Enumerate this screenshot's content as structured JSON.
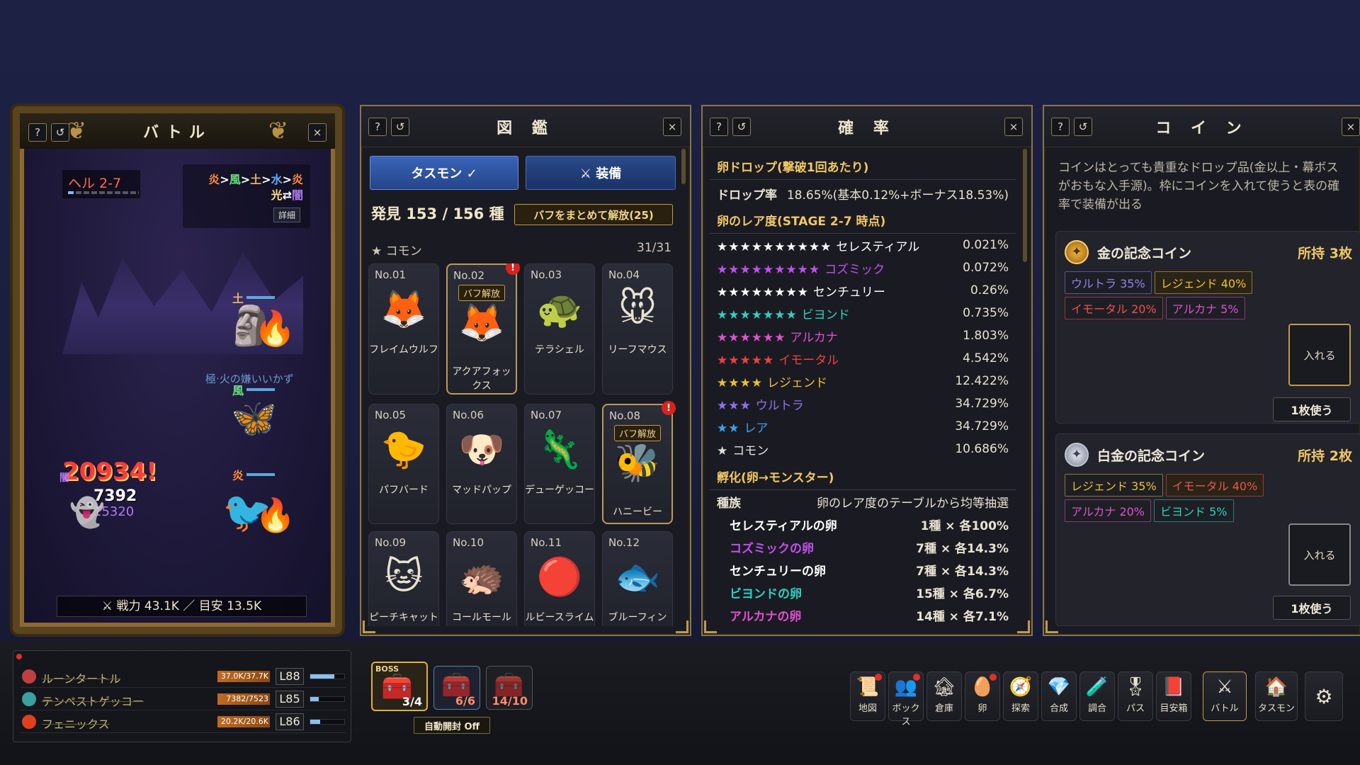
{
  "battle": {
    "title": "バトル",
    "stage": "ヘル 2-7",
    "elements_line1_parts": [
      "炎",
      ">",
      "風",
      ">",
      "土",
      ">",
      "水",
      ">",
      "炎"
    ],
    "elements_line2_parts": [
      "光",
      "⇄",
      "闇"
    ],
    "detail_btn": "詳細",
    "dmg_big": "20934!",
    "dmg_small": "7392",
    "dmg_small2": "15320",
    "enemy_label": "極·火の嫌いいかず",
    "el_tag_1": "土",
    "el_tag_2": "風",
    "el_tag_3": "炎",
    "el_tag_4": "闇",
    "power": "⚔ 戦力 43.1K ／ 目安 13.5K"
  },
  "zukan": {
    "title": "図 鑑",
    "tab_tasmon": "タスモン ✓",
    "tab_equip": "⚔ 装備",
    "found": "発見 153 / 156 種",
    "buff_all": "バフをまとめて解放(25)",
    "rarity": "★ コモン",
    "rarity_count": "31/31",
    "cells": [
      {
        "no": "No.01",
        "name": "フレイムウルフ",
        "emoji": "🦊",
        "badge": "",
        "excl": false
      },
      {
        "no": "No.02",
        "name": "アクアフォックス",
        "emoji": "🦊",
        "badge": "バフ解放",
        "excl": true
      },
      {
        "no": "No.03",
        "name": "テラシェル",
        "emoji": "🐢",
        "badge": "",
        "excl": false
      },
      {
        "no": "No.04",
        "name": "リーフマウス",
        "emoji": "🐭",
        "badge": "",
        "excl": false
      },
      {
        "no": "No.05",
        "name": "パフバード",
        "emoji": "🐤",
        "badge": "",
        "excl": false
      },
      {
        "no": "No.06",
        "name": "マッドパップ",
        "emoji": "🐶",
        "badge": "",
        "excl": false
      },
      {
        "no": "No.07",
        "name": "デューゲッコー",
        "emoji": "🦎",
        "badge": "",
        "excl": false
      },
      {
        "no": "No.08",
        "name": "ハニービー",
        "emoji": "🐝",
        "badge": "バフ解放",
        "excl": true
      },
      {
        "no": "No.09",
        "name": "ピーチキャット",
        "emoji": "🐱",
        "badge": "",
        "excl": false
      },
      {
        "no": "No.10",
        "name": "コールモール",
        "emoji": "🦔",
        "badge": "",
        "excl": false
      },
      {
        "no": "No.11",
        "name": "ルビースライム",
        "emoji": "🔴",
        "badge": "",
        "excl": false
      },
      {
        "no": "No.12",
        "name": "ブルーフィン",
        "emoji": "🐟",
        "badge": "",
        "excl": false
      }
    ]
  },
  "prob": {
    "title": "確 率",
    "sec1": "卵ドロップ(撃破1回あたり)",
    "drop_label": "ドロップ率",
    "drop_value": "18.65%(基本0.12%+ボーナス18.53%)",
    "sec2": "卵のレア度(STAGE 2-7 時点)",
    "rarities": [
      {
        "stars": "★★★★★★★★★★",
        "name": "セレスティアル",
        "pct": "0.021%",
        "color": "#ffffff"
      },
      {
        "stars": "★★★★★★★★★",
        "name": "コズミック",
        "pct": "0.072%",
        "color": "#c050f0"
      },
      {
        "stars": "★★★★★★★★",
        "name": "センチュリー",
        "pct": "0.26%",
        "color": "#ffffff"
      },
      {
        "stars": "★★★★★★★",
        "name": "ビヨンド",
        "pct": "0.735%",
        "color": "#30d0c0"
      },
      {
        "stars": "★★★★★★",
        "name": "アルカナ",
        "pct": "1.803%",
        "color": "#e050d0"
      },
      {
        "stars": "★★★★★",
        "name": "イモータル",
        "pct": "4.542%",
        "color": "#f04040"
      },
      {
        "stars": "★★★★",
        "name": "レジェンド",
        "pct": "12.422%",
        "color": "#f0c030"
      },
      {
        "stars": "★★★",
        "name": "ウルトラ",
        "pct": "34.729%",
        "color": "#9070f0"
      },
      {
        "stars": "★★",
        "name": "レア",
        "pct": "34.729%",
        "color": "#40a0f0"
      },
      {
        "stars": "★",
        "name": "コモン",
        "pct": "10.686%",
        "color": "#e0e0e0"
      }
    ],
    "sec3": "孵化(卵→モンスター)",
    "hatch_label": "種族",
    "hatch_value": "卵のレア度のテーブルから均等抽選",
    "eggs": [
      {
        "name": "セレスティアルの卵",
        "val": "1種 × 各100%",
        "color": "#ffffff"
      },
      {
        "name": "コズミックの卵",
        "val": "7種 × 各14.3%",
        "color": "#c050f0"
      },
      {
        "name": "センチュリーの卵",
        "val": "7種 × 各14.3%",
        "color": "#ffffff"
      },
      {
        "name": "ビヨンドの卵",
        "val": "15種 × 各6.7%",
        "color": "#30d0c0"
      },
      {
        "name": "アルカナの卵",
        "val": "14種 × 各7.1%",
        "color": "#e050d0"
      }
    ]
  },
  "coin": {
    "title": "コ イ ン",
    "desc": "コインはとっても貴重なドロップ品(金以上・幕ボスがおもな入手源)。枠にコインを入れて使うと表の確率で装備が出る",
    "gold_name": "金の記念コイン",
    "gold_own": "所持 3枚",
    "gold_tags": [
      {
        "t": "ウルトラ 35%",
        "c": "#9080f0"
      },
      {
        "t": "レジェンド 40%",
        "c": "#f0c030"
      },
      {
        "t": "イモータル 20%",
        "c": "#f05050"
      },
      {
        "t": "アルカナ 5%",
        "c": "#e050d0"
      }
    ],
    "plat_name": "白金の記念コイン",
    "plat_own": "所持 2枚",
    "plat_tags": [
      {
        "t": "レジェンド 35%",
        "c": "#f0c030"
      },
      {
        "t": "イモータル 40%",
        "c": "#f05050"
      },
      {
        "t": "アルカナ 20%",
        "c": "#e050d0"
      },
      {
        "t": "ビヨンド 5%",
        "c": "#30d0c0"
      }
    ],
    "insert": "入れる",
    "use": "1枚使う"
  },
  "party": [
    {
      "name": "ルーンタートル",
      "hp": "37.0K/37.7K",
      "lv": "L88",
      "hpfrac": 0.98,
      "xpfrac": 0.7,
      "color": "#c04040"
    },
    {
      "name": "テンペストゲッコー",
      "hp": "7382/7523",
      "lv": "L85",
      "hpfrac": 0.98,
      "xpfrac": 0.25,
      "color": "#3aa0a0"
    },
    {
      "name": "フェニックス",
      "hp": "20.2K/20.6K",
      "lv": "L86",
      "hpfrac": 0.98,
      "xpfrac": 0.3,
      "color": "#e04020"
    }
  ],
  "chests": {
    "boss": "BOSS",
    "c1": "3/4",
    "c2": "6/6",
    "c3": "14/10",
    "auto": "自動開封 Off"
  },
  "dock": [
    {
      "lb": "地図",
      "ic": "📜",
      "dot": true
    },
    {
      "lb": "ボックス",
      "ic": "👥",
      "dot": true
    },
    {
      "lb": "倉庫",
      "ic": "🏚",
      "dot": false
    },
    {
      "lb": "卵",
      "ic": "🥚",
      "dot": true
    },
    {
      "lb": "探索",
      "ic": "🧭",
      "dot": false
    },
    {
      "lb": "合成",
      "ic": "💎",
      "dot": false
    },
    {
      "lb": "調合",
      "ic": "🧪",
      "dot": false
    },
    {
      "lb": "パス",
      "ic": "🎖",
      "dot": false
    },
    {
      "lb": "目安箱",
      "ic": "📕",
      "dot": false
    },
    {
      "lb": "バトル",
      "ic": "⚔",
      "dot": false
    },
    {
      "lb": "タスモン",
      "ic": "🏠",
      "dot": false
    }
  ],
  "gear": "⚙"
}
